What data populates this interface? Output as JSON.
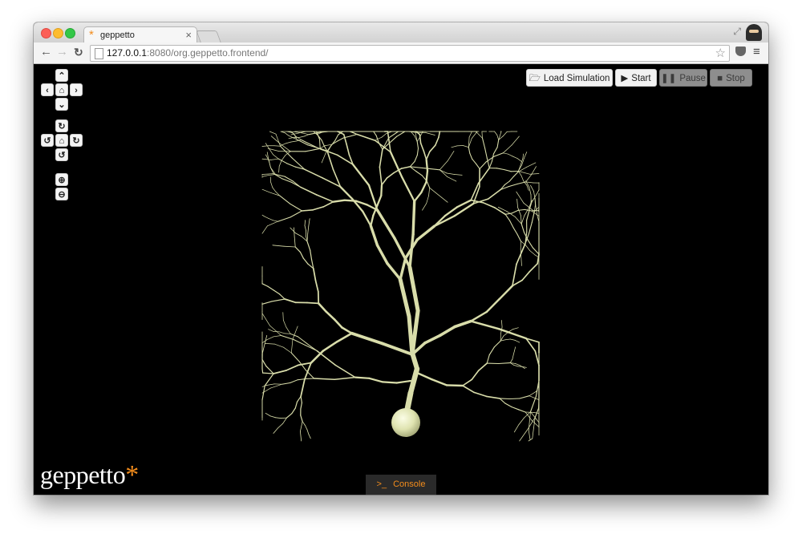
{
  "browser": {
    "tab": {
      "title": "geppetto",
      "favicon_glyph": "*",
      "close_glyph": "×"
    },
    "address": {
      "host": "127.0.0.1",
      "rest": ":8080/org.geppetto.frontend/"
    },
    "icons": {
      "back": "back-arrow-icon",
      "forward": "forward-arrow-icon",
      "reload": "reload-icon",
      "star": "bookmark-star-icon",
      "pocket": "pocket-icon",
      "menu": "hamburger-menu-icon",
      "fullscreen": "fullscreen-icon",
      "profile": "profile-avatar-icon"
    }
  },
  "viewer": {
    "pan": [
      "chevron-up-icon",
      "chevron-left-icon",
      "home-icon",
      "chevron-right-icon",
      "chevron-down-icon"
    ],
    "rotate": [
      "rotate-up-icon",
      "rotate-left-icon",
      "home-icon",
      "rotate-right-icon",
      "rotate-down-icon"
    ],
    "zoom": [
      "zoom-in-icon",
      "zoom-out-icon"
    ]
  },
  "simulation": {
    "load_label": "Load Simulation",
    "start_label": "Start",
    "pause_label": "Pause",
    "stop_label": "Stop"
  },
  "logo": {
    "text": "geppetto",
    "mark": "*"
  },
  "console": {
    "label": "Console",
    "prompt": ">_"
  },
  "colors": {
    "accent_orange": "#f28c1c",
    "neuron_dendrite": "#d9ddaa",
    "canvas_background": "#000000"
  }
}
